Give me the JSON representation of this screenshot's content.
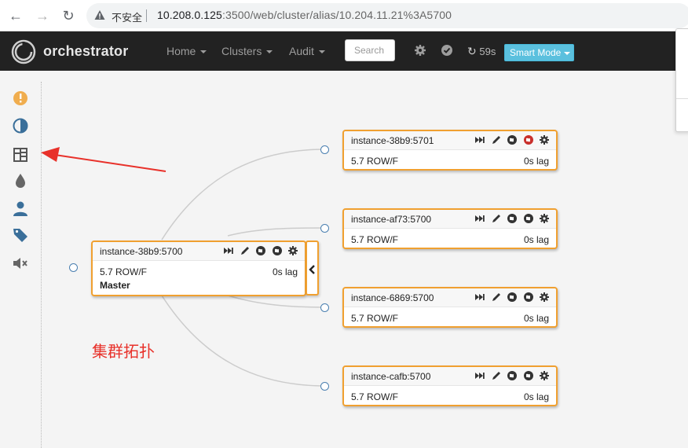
{
  "browser": {
    "security_label": "不安全",
    "url_host": "10.208.0.125",
    "url_rest": ":3500/web/cluster/alias/10.204.11.21%3A5700"
  },
  "navbar": {
    "brand": "orchestrator",
    "menus": [
      {
        "label": "Home"
      },
      {
        "label": "Clusters"
      },
      {
        "label": "Audit"
      }
    ],
    "search_placeholder": "Search",
    "refresh_countdown": "59s",
    "mode_label": "Smart Mode"
  },
  "sidebar": {
    "icons": [
      "alert-icon",
      "contrast-icon",
      "list-icon",
      "drop-icon",
      "user-icon",
      "tag-icon",
      "mute-icon"
    ]
  },
  "topology": {
    "master": {
      "name": "instance-38b9:5700",
      "version": "5.7 ROW/F",
      "lag": "0s lag",
      "role": "Master"
    },
    "replicas": [
      {
        "name": "instance-38b9:5701",
        "version": "5.7 ROW/F",
        "lag": "0s lag"
      },
      {
        "name": "instance-af73:5700",
        "version": "5.7 ROW/F",
        "lag": "0s lag"
      },
      {
        "name": "instance-6869:5700",
        "version": "5.7 ROW/F",
        "lag": "0s lag"
      },
      {
        "name": "instance-cafb:5700",
        "version": "5.7 ROW/F",
        "lag": "0s lag"
      }
    ]
  },
  "annotation": {
    "text": "集群拓扑"
  },
  "colors": {
    "instance_border": "#f0a030",
    "navbar_bg": "#222222",
    "smart_mode": "#5bc0de",
    "annotation": "#e8312a"
  }
}
